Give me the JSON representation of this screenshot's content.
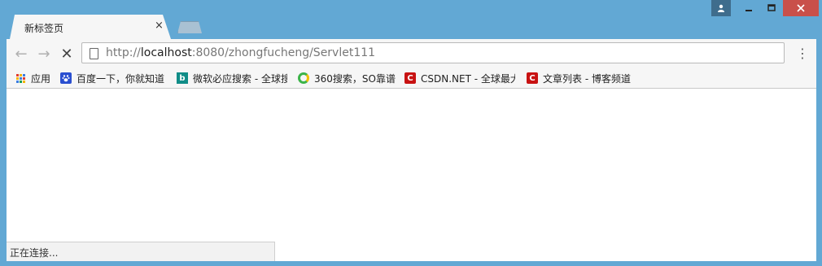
{
  "window": {
    "controls": [
      "user-icon",
      "minimize-icon",
      "maximize-icon",
      "close-icon"
    ]
  },
  "tab": {
    "title": "新标签页",
    "close_symbol": "×"
  },
  "toolbar": {
    "back_symbol": "←",
    "forward_symbol": "→",
    "reload_symbol": "✕",
    "url_prefix": "http://",
    "url_host": "localhost",
    "url_rest": ":8080/zhongfucheng/Servlet111",
    "menu_symbol": "⋮"
  },
  "bookmarks": [
    {
      "label": "应用",
      "icon": "apps-icon"
    },
    {
      "label": "百度一下，你就知道",
      "icon": "baidu-icon"
    },
    {
      "label": "微软必应搜索 - 全球搜",
      "icon": "bing-icon"
    },
    {
      "label": "360搜索，SO靠谱",
      "icon": "360-icon"
    },
    {
      "label": "CSDN.NET - 全球最大",
      "icon": "csdn-icon"
    },
    {
      "label": "文章列表 - 博客频道",
      "icon": "csdn-icon"
    }
  ],
  "status": {
    "text": "正在连接..."
  },
  "colors": {
    "frame": "#62a8d4",
    "close": "#c9504a",
    "csdn": "#c81212",
    "bing": "#108d88",
    "baidu": "#2a4fd0"
  }
}
